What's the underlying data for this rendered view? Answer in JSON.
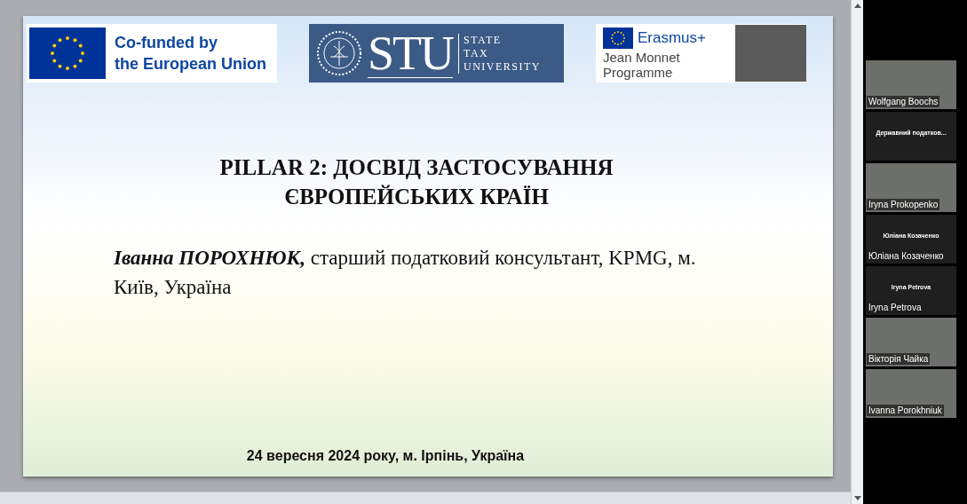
{
  "slide": {
    "logos": [
      {
        "kind": "eu",
        "lines": [
          "Co-funded by",
          "the European Union"
        ]
      },
      {
        "kind": "stu",
        "mark": "STU",
        "lines": [
          "STATE",
          "TAX",
          "UNIVERSITY"
        ]
      },
      {
        "kind": "erasmus",
        "lines": [
          "Erasmus+",
          "Jean Monnet",
          "Programme"
        ]
      }
    ],
    "title_lines": [
      "PILLAR 2: ДОСВІД ЗАСТОСУВАННЯ",
      "ЄВРОПЕЙСЬКИХ КРАЇН"
    ],
    "author": "**Іванна ПОРОХНЮК,** старший податковий консультант, KPMG, м. Київ, Україна",
    "date": "24 вересня 2024 року, м. Ірпінь, Україна"
  },
  "participants": [
    {
      "kind": "video",
      "label": "Wolfgang Boochs"
    },
    {
      "kind": "name_only",
      "caption": "Державний податков..."
    },
    {
      "kind": "video",
      "label": "Iryna Prokopenko"
    },
    {
      "kind": "name_only",
      "caption": "Юліана Козаченко",
      "label": "Юліана Козаченко"
    },
    {
      "kind": "name_only",
      "caption": "Iryna Petrova",
      "label": "Iryna Petrova"
    },
    {
      "kind": "video",
      "label": "Вікторія Чайка"
    },
    {
      "kind": "video",
      "label": "Ivanna Porokhniuk"
    }
  ]
}
